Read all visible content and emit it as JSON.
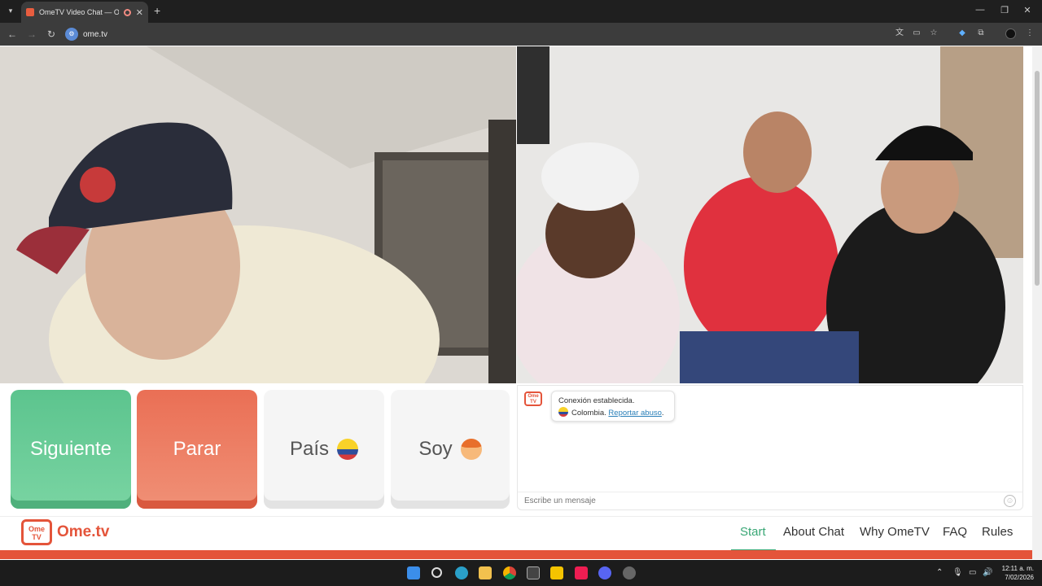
{
  "browser": {
    "tab_title": "OmeTV Video Chat — Ome",
    "url": "ome.tv",
    "new_tab_symbol": "+",
    "close_symbol": "✕"
  },
  "controls": {
    "next_label": "Siguiente",
    "stop_label": "Parar",
    "country_label": "País",
    "soy_label": "Soy"
  },
  "chat": {
    "logo_text": "Ome TV",
    "connection_text": "Conexión establecida.",
    "country_text": "Colombia.",
    "report_link": "Reportar abuso",
    "report_suffix": ".",
    "input_placeholder": "Escribe un mensaje"
  },
  "footer": {
    "logo_text": "Ome TV",
    "brand": "Ome.tv",
    "nav": [
      "Start",
      "About Chat",
      "Why OmeTV",
      "FAQ",
      "Rules"
    ],
    "active_nav": "Start"
  },
  "taskbar": {
    "time": "12:11 a. m.",
    "date": "7/02/2026"
  },
  "colors": {
    "accent_green": "#5cc48e",
    "accent_red": "#ea6f55",
    "brand_orange": "#e4543a"
  }
}
